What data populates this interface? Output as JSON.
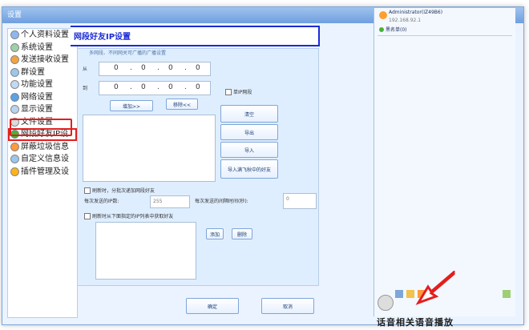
{
  "window": {
    "title": "设置"
  },
  "nav": {
    "items": [
      {
        "label": "个人资料设置",
        "icon": "user-icon"
      },
      {
        "label": "系统设置",
        "icon": "gear-icon"
      },
      {
        "label": "发送接收设置",
        "icon": "transfer-icon"
      },
      {
        "label": "群设置",
        "icon": "group-icon"
      },
      {
        "label": "功能设置",
        "icon": "function-icon"
      },
      {
        "label": "网络设置",
        "icon": "globe-icon"
      },
      {
        "label": "显示设置",
        "icon": "display-icon"
      },
      {
        "label": "文件设置",
        "icon": "file-icon"
      },
      {
        "label": "网段好友IP设",
        "icon": "network-segment-icon"
      },
      {
        "label": "屏蔽垃圾信息",
        "icon": "shield-icon"
      },
      {
        "label": "自定义信息设",
        "icon": "edit-icon"
      },
      {
        "label": "插件管理及设",
        "icon": "plugin-icon"
      }
    ],
    "selected_index": 8
  },
  "page": {
    "title": "网段好友IP设置",
    "hint": "多网段、不同网关可广播的广播设置",
    "from_label": "从",
    "to_label": "到",
    "from_ip": [
      "0",
      "0",
      "0",
      "0"
    ],
    "to_ip": [
      "0",
      "0",
      "0",
      "0"
    ],
    "single_ip_label": "单IP网段",
    "add_label": "增加>>",
    "remove_label": "移除<<",
    "clear_label": "清空",
    "export_label": "导出",
    "import_label": "导入",
    "import_feiq_label": "导入满飞秋中的好友",
    "refresh_label": "刷新时，分批次递加网段好友",
    "per_batch_label": "每次发送的IP数:",
    "per_batch_value": "255",
    "interval_label": "每次发送的间隔时间(秒):",
    "interval_value": "0",
    "fetch_label": "刷新时从下面指定的IP列表中获取好友",
    "add2_label": "添加",
    "delete_label": "删除",
    "ok_label": "确定",
    "cancel_label": "取消"
  },
  "right": {
    "user": "Administrator(IZ49B6)",
    "ip": "192.168.92.1",
    "blacklist": "黑名单(0)"
  },
  "bottom_text": "话音相关语音播放"
}
